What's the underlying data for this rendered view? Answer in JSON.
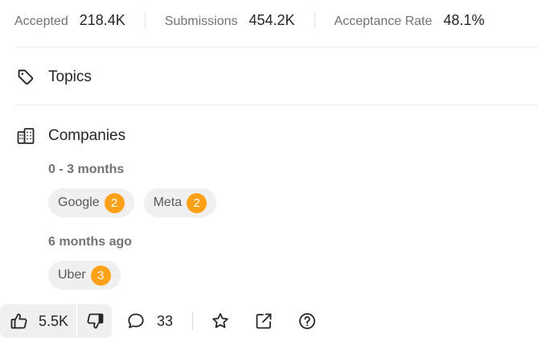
{
  "stats": {
    "accepted": {
      "label": "Accepted",
      "value": "218.4K"
    },
    "submissions": {
      "label": "Submissions",
      "value": "454.2K"
    },
    "acceptance_rate": {
      "label": "Acceptance Rate",
      "value": "48.1%"
    }
  },
  "topics": {
    "title": "Topics",
    "icon": "tag-icon"
  },
  "companies": {
    "title": "Companies",
    "icon": "building-icon",
    "groups": [
      {
        "period": "0 - 3 months",
        "items": [
          {
            "name": "Google",
            "count": "2"
          },
          {
            "name": "Meta",
            "count": "2"
          }
        ]
      },
      {
        "period": "6 months ago",
        "items": [
          {
            "name": "Uber",
            "count": "3"
          }
        ]
      }
    ]
  },
  "actions": {
    "likes": "5.5K",
    "comments": "33",
    "like_icon": "thumbs-up-icon",
    "dislike_icon": "thumbs-down-icon",
    "comment_icon": "comment-icon",
    "star_icon": "star-icon",
    "share_icon": "share-icon",
    "help_icon": "help-icon"
  },
  "colors": {
    "badge": "#ffa116",
    "chip_bg": "#f0f0f0",
    "muted_text": "#737373",
    "text": "#262626"
  }
}
